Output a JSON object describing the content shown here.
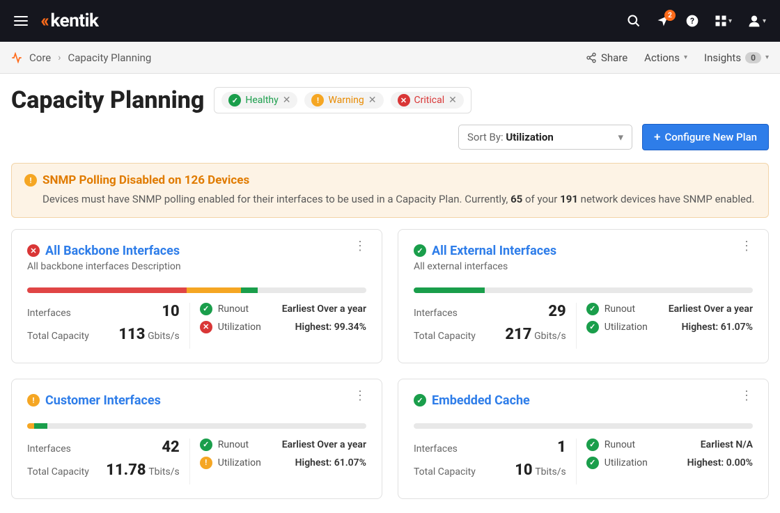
{
  "nav": {
    "notif_count": "2"
  },
  "breadcrumb": {
    "core": "Core",
    "page": "Capacity Planning",
    "share": "Share",
    "actions": "Actions",
    "insights": "Insights",
    "insights_count": "0"
  },
  "header": {
    "title": "Capacity Planning",
    "filter_healthy": "Healthy",
    "filter_warning": "Warning",
    "filter_critical": "Critical",
    "sort_prefix": "Sort By: ",
    "sort_value": "Utilization",
    "configure_btn": "Configure New Plan"
  },
  "alert": {
    "title": "SNMP Polling Disabled on 126 Devices",
    "body_1": "Devices must have SNMP polling enabled for their interfaces to be used in a Capacity Plan. Currently, ",
    "body_b1": "65",
    "body_2": " of your ",
    "body_b2": "191",
    "body_3": " network devices have SNMP enabled."
  },
  "labels": {
    "interfaces": "Interfaces",
    "total_capacity": "Total Capacity",
    "runout": "Runout",
    "utilization": "Utilization"
  },
  "cards": [
    {
      "status": "critical",
      "title": "All Backbone Interfaces",
      "desc": "All backbone interfaces Description",
      "interfaces": "10",
      "capacity_num": "113",
      "capacity_unit": "Gbits/s",
      "runout_status": "healthy",
      "runout_val": "Earliest Over a year",
      "util_status": "critical",
      "util_val": "Highest: 99.34%",
      "bar": [
        {
          "c": "red",
          "w": 47
        },
        {
          "c": "orange",
          "w": 16
        },
        {
          "c": "green",
          "w": 5
        }
      ]
    },
    {
      "status": "healthy",
      "title": "All External Interfaces",
      "desc": "All external interfaces",
      "interfaces": "29",
      "capacity_num": "217",
      "capacity_unit": "Gbits/s",
      "runout_status": "healthy",
      "runout_val": "Earliest Over a year",
      "util_status": "healthy",
      "util_val": "Highest: 61.07%",
      "bar": [
        {
          "c": "green",
          "w": 21
        }
      ]
    },
    {
      "status": "warning",
      "title": "Customer Interfaces",
      "desc": "",
      "interfaces": "42",
      "capacity_num": "11.78",
      "capacity_unit": "Tbits/s",
      "runout_status": "healthy",
      "runout_val": "Earliest Over a year",
      "util_status": "warning",
      "util_val": "Highest: 61.07%",
      "bar": [
        {
          "c": "orange",
          "w": 2
        },
        {
          "c": "green",
          "w": 4
        }
      ]
    },
    {
      "status": "healthy",
      "title": "Embedded Cache",
      "desc": "",
      "interfaces": "1",
      "capacity_num": "10",
      "capacity_unit": "Tbits/s",
      "runout_status": "healthy",
      "runout_val": "Earliest N/A",
      "util_status": "healthy",
      "util_val": "Highest: 0.00%",
      "bar": []
    }
  ]
}
